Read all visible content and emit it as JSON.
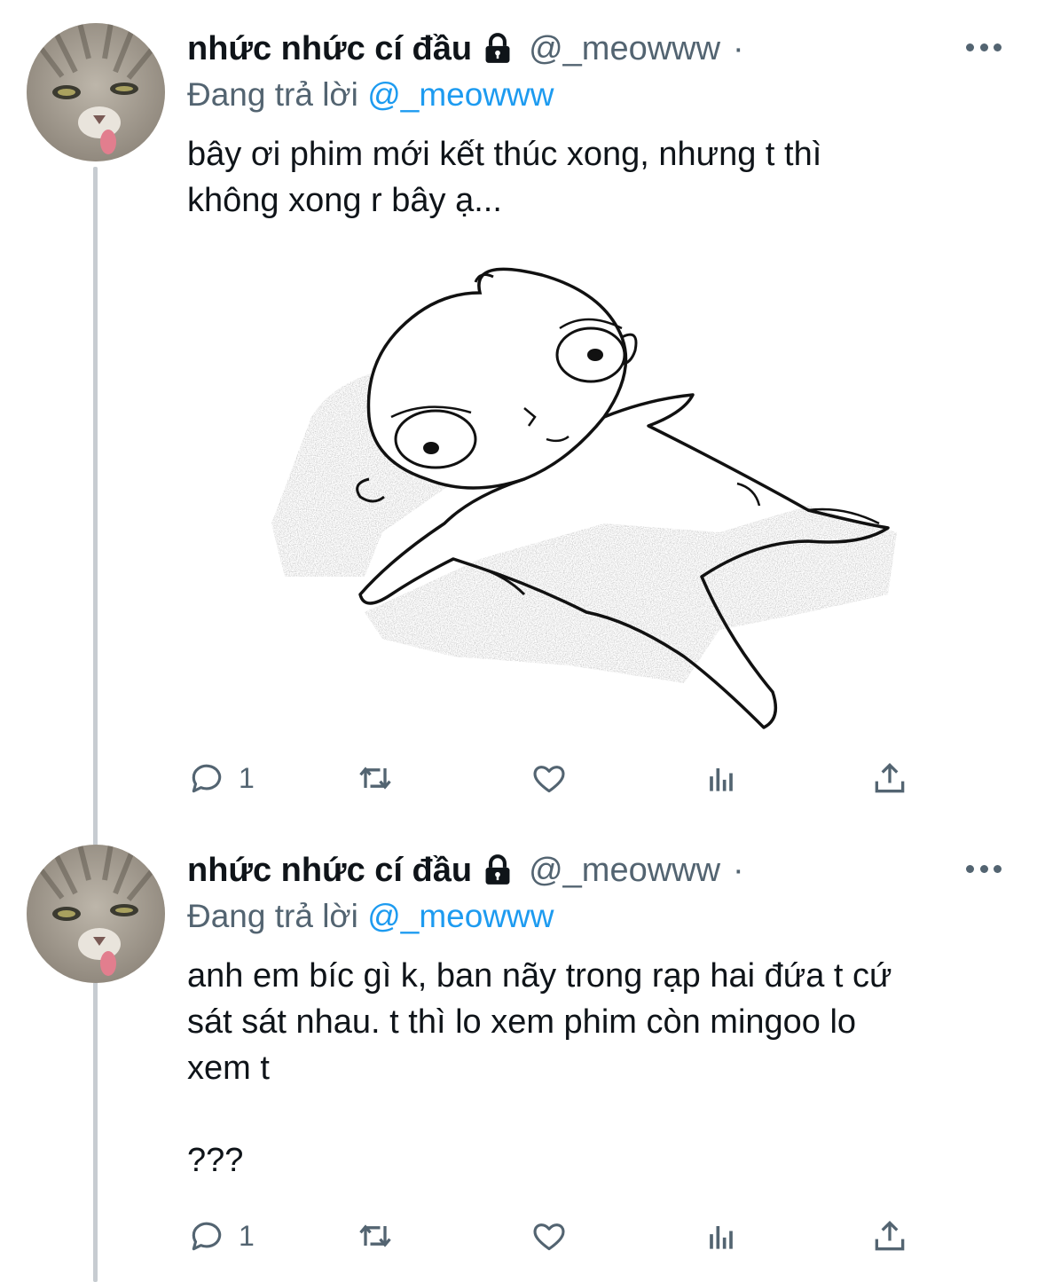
{
  "tweets": [
    {
      "display_name": "nhức nhức cí đầu",
      "handle": "@_meowww",
      "separator": "·",
      "replying_prefix": "Đang trả lời",
      "replying_to": "@_meowww",
      "text_lines": [
        "bây ơi phim mới kết thúc xong, nhưng t thì",
        "không xong r bây ạ..."
      ],
      "has_media": true,
      "reply_count": "1"
    },
    {
      "display_name": "nhức nhức cí đầu",
      "handle": "@_meowww",
      "separator": "·",
      "replying_prefix": "Đang trả lời",
      "replying_to": "@_meowww",
      "text_lines": [
        "anh em bíc gì k, ban nãy trong rạp hai đứa t cứ",
        "sát sát nhau. t thì lo xem phim còn mingoo lo",
        "xem t",
        "",
        "???"
      ],
      "has_media": false,
      "reply_count": "1"
    }
  ],
  "icons": {
    "more": "more-horizontal-icon",
    "lock": "lock-icon",
    "reply": "reply-bubble-icon",
    "retweet": "retweet-icon",
    "like": "heart-icon",
    "views": "analytics-bars-icon",
    "share": "share-upload-icon"
  },
  "colors": {
    "text": "#0f1419",
    "secondary": "#536471",
    "link": "#1d9bf0",
    "thread_line": "#c7ccd1"
  }
}
